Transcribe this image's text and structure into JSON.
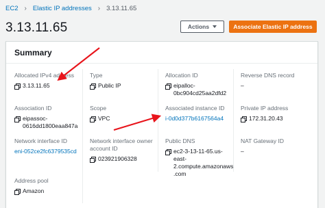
{
  "breadcrumb": {
    "items": [
      "EC2",
      "Elastic IP addresses"
    ],
    "current": "3.13.11.65"
  },
  "page": {
    "title": "3.13.11.65",
    "actions_label": "Actions",
    "associate_label": "Associate Elastic IP address"
  },
  "summary": {
    "title": "Summary",
    "fields": {
      "allocated_ipv4": {
        "label": "Allocated IPv4 address",
        "value": "3.13.11.65"
      },
      "type": {
        "label": "Type",
        "value": "Public IP"
      },
      "allocation_id": {
        "label": "Allocation ID",
        "value": "eipalloc-\n0bc904cd25aa2dfd2"
      },
      "reverse_dns": {
        "label": "Reverse DNS record",
        "value": "–"
      },
      "association_id": {
        "label": "Association ID",
        "value": "eipassoc-\n0616dd1800eaa847a"
      },
      "scope": {
        "label": "Scope",
        "value": "VPC"
      },
      "associated_instance": {
        "label": "Associated instance ID",
        "value": "i-0d0d377b6167564a4"
      },
      "private_ip": {
        "label": "Private IP address",
        "value": "172.31.20.43"
      },
      "network_interface_id": {
        "label": "Network interface ID",
        "value": "eni-052ce2fc6379535cd"
      },
      "network_interface_owner": {
        "label": "Network interface owner\naccount ID",
        "value": "023921906328"
      },
      "public_dns": {
        "label": "Public DNS",
        "value": "ec2-3-13-11-65.us-\neast-2.compute.amazonaws\n.com"
      },
      "nat_gateway": {
        "label": "NAT Gateway ID",
        "value": "–"
      },
      "address_pool": {
        "label": "Address pool",
        "value": "Amazon"
      }
    }
  },
  "colors": {
    "accent_orange": "#ec7211",
    "link_blue": "#0073bb",
    "annotation_red": "#e8141b"
  }
}
